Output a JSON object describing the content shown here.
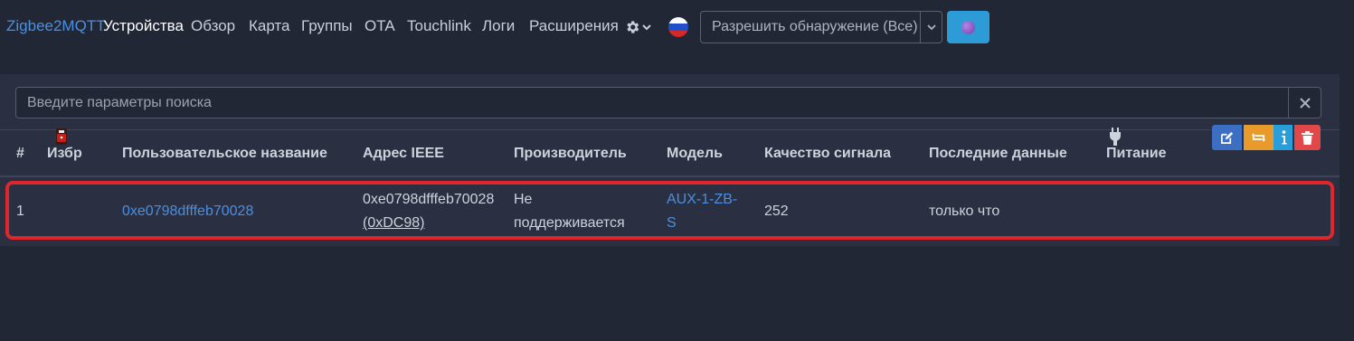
{
  "navbar": {
    "brand": "Zigbee2MQTT",
    "items": [
      {
        "label": "Устройства",
        "active": true
      },
      {
        "label": "Обзор"
      },
      {
        "label": "Карта"
      },
      {
        "label": "Группы"
      },
      {
        "label": "OTA"
      },
      {
        "label": "Touchlink"
      },
      {
        "label": "Логи"
      },
      {
        "label": "Расширения"
      }
    ],
    "settings_icon": "gear-icon",
    "language_icon": "russian-flag-icon",
    "permit_join_label": "Разрешить обнаружение (Все)",
    "theme_icon": "purple-circle-icon"
  },
  "search": {
    "placeholder": "Введите параметры поиска",
    "value": "",
    "clear_icon": "close-icon"
  },
  "table": {
    "headers": [
      "#",
      "Избр",
      "Пользовательское название",
      "Адрес IEEE",
      "Производитель",
      "Модель",
      "Качество сигнала",
      "Последние данные",
      "Питание"
    ],
    "rows": [
      {
        "index": "1",
        "image_icon": "device-thumbnail-icon",
        "friendly_name": "0xe0798dfffeb70028",
        "ieee_address": "0xe0798dfffeb70028",
        "network_address": "(0xDC98)",
        "manufacturer_line1": "Не",
        "manufacturer_line2": "поддерживается",
        "model_line1": "AUX-1-ZB-",
        "model_line2": "S",
        "link_quality": "252",
        "last_seen": "только что",
        "power_icon": "plug-icon",
        "actions": [
          "edit-icon",
          "swap-icon",
          "info-icon",
          "trash-icon"
        ]
      }
    ]
  },
  "colors": {
    "background": "#222736",
    "card": "#2a3042",
    "link": "#4b8fe0",
    "highlight": "#e0252b",
    "edit": "#3c6fc4",
    "swap": "#e89a2b",
    "info": "#2a9ed8",
    "delete": "#e0484a"
  }
}
